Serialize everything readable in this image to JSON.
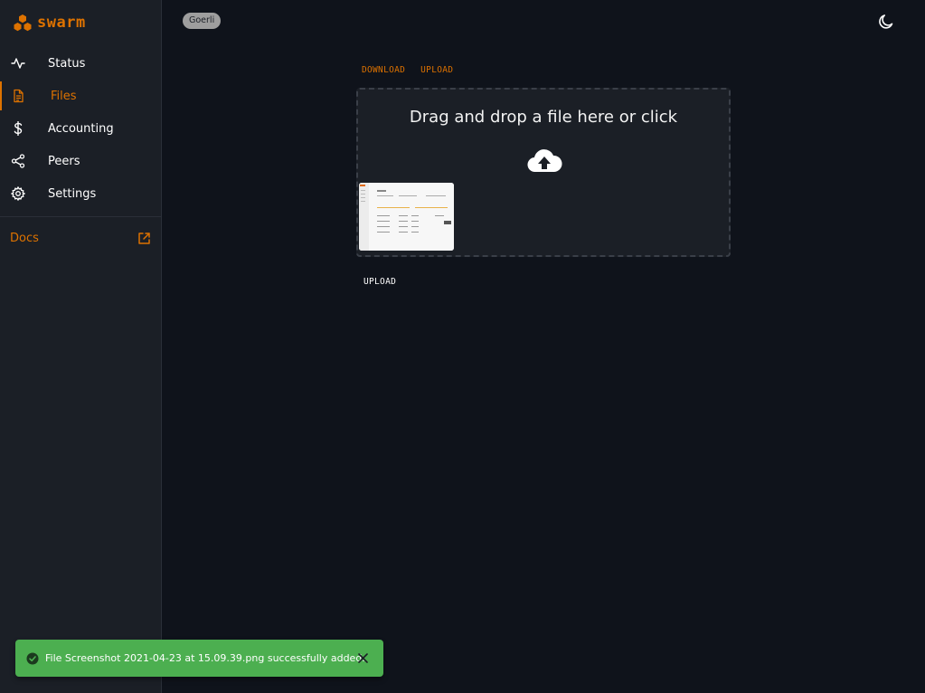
{
  "brand": {
    "name": "swarm",
    "accent": "#dd7200"
  },
  "sidebar": {
    "items": [
      {
        "label": "Status",
        "icon": "activity-icon",
        "active": false
      },
      {
        "label": "Files",
        "icon": "file-icon",
        "active": true
      },
      {
        "label": "Accounting",
        "icon": "dollar-icon",
        "active": false
      },
      {
        "label": "Peers",
        "icon": "share-icon",
        "active": false
      },
      {
        "label": "Settings",
        "icon": "gear-icon",
        "active": false
      }
    ],
    "docs_label": "Docs"
  },
  "header": {
    "network": "Goerli",
    "theme_icon": "moon-icon"
  },
  "main": {
    "tabs": [
      {
        "label": "DOWNLOAD"
      },
      {
        "label": "UPLOAD"
      }
    ],
    "dropzone_text": "Drag and drop a file here or click",
    "dropzone_icon": "cloud-upload-icon",
    "upload_label": "UPLOAD"
  },
  "toast": {
    "message": "File Screenshot 2021-04-23 at 15.09.39.png successfully added.",
    "color": "#4caf50"
  }
}
